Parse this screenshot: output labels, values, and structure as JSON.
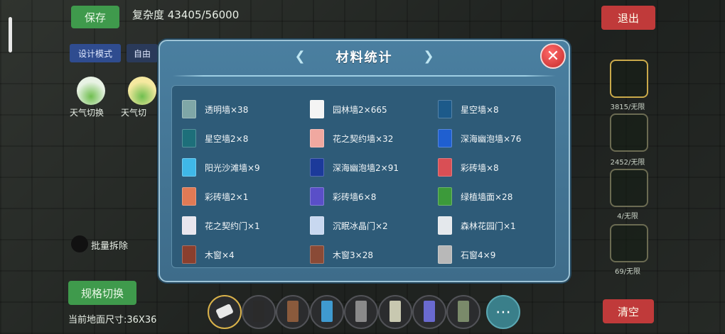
{
  "hud": {
    "save_label": "保存",
    "complexity_text": "复杂度 43405/56000",
    "design_mode_label": "设计模式",
    "free_label": "自由",
    "exit_label": "退出",
    "clear_label": "清空",
    "spec_switch_label": "规格切换",
    "size_text": "当前地面尺寸:36X36",
    "left_label_a": "天气切换",
    "left_label_b": "天气切",
    "batch_label": "批量拆除",
    "side_counts": [
      "3815/无限",
      "2452/无限",
      "4/无限",
      "69/无限"
    ]
  },
  "modal": {
    "title": "材料统计",
    "close_glyph": "✕",
    "items": [
      {
        "label": "透明墙×38",
        "color": "#7fa7a7"
      },
      {
        "label": "园林墙2×665",
        "color": "#f4f4f4"
      },
      {
        "label": "星空墙×8",
        "color": "#1c5a8a"
      },
      {
        "label": "星空墙2×8",
        "color": "#1d6f7a"
      },
      {
        "label": "花之契约墙×32",
        "color": "#f0a8a0"
      },
      {
        "label": "深海幽泡墙×76",
        "color": "#1f5fd0"
      },
      {
        "label": "阳光沙滩墙×9",
        "color": "#3fb8e8"
      },
      {
        "label": "深海幽泡墙2×91",
        "color": "#1c3a9a"
      },
      {
        "label": "彩砖墙×8",
        "color": "#d94f55"
      },
      {
        "label": "彩砖墙2×1",
        "color": "#e07a55"
      },
      {
        "label": "彩砖墙6×8",
        "color": "#5a4fc8"
      },
      {
        "label": "绿植墙面×28",
        "color": "#3c9a3a"
      },
      {
        "label": "花之契约门×1",
        "color": "#e8e6ee"
      },
      {
        "label": "沉眠冰晶门×2",
        "color": "#c8d8f0"
      },
      {
        "label": "森林花园门×1",
        "color": "#e4e8ec"
      },
      {
        "label": "木窗×4",
        "color": "#8a3f2e"
      },
      {
        "label": "木窗3×28",
        "color": "#8a4a36"
      },
      {
        "label": "石窗4×9",
        "color": "#b8b8b8"
      }
    ]
  },
  "toolbar": {
    "swatches": [
      "#2b2b2b",
      "#8a5a3c",
      "#3f9ad0",
      "#8a8a8a",
      "#c8c8b0",
      "#6a6ad0",
      "#7a8a6a"
    ],
    "more_glyph": "⋯"
  }
}
